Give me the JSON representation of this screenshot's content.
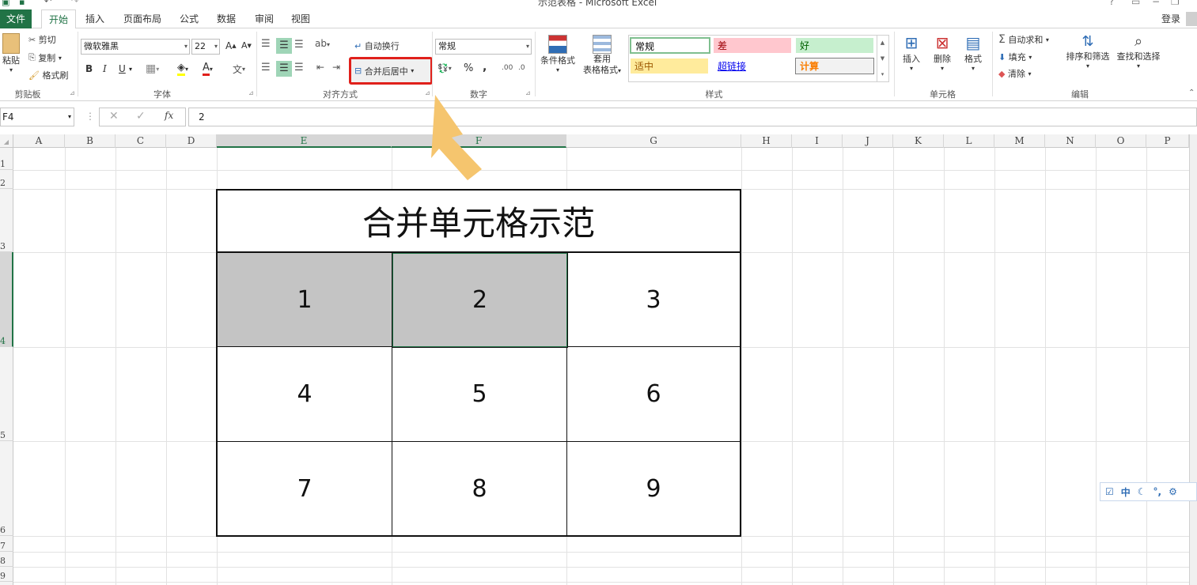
{
  "window": {
    "title": "示范表格 - Microsoft Excel",
    "login": "登录"
  },
  "tabs": [
    {
      "label": "文件"
    },
    {
      "label": "开始"
    },
    {
      "label": "插入"
    },
    {
      "label": "页面布局"
    },
    {
      "label": "公式"
    },
    {
      "label": "数据"
    },
    {
      "label": "审阅"
    },
    {
      "label": "视图"
    }
  ],
  "clipboard": {
    "paste": "粘贴",
    "cut": "剪切",
    "copy": "复制",
    "format_painter": "格式刷",
    "group": "剪贴板"
  },
  "font": {
    "name": "微软雅黑",
    "size": "22",
    "bold": "B",
    "italic": "I",
    "underline": "U",
    "grow": "A",
    "shrink": "A",
    "color_letter": "A",
    "wen": "文",
    "group": "字体"
  },
  "alignment": {
    "wrap_text": "自动换行",
    "merge_center": "合并后居中",
    "group": "对齐方式"
  },
  "number": {
    "format": "常规",
    "percent": "%",
    "comma": ",",
    "group": "数字"
  },
  "styles": {
    "conditional": "条件格式",
    "table_format": [
      "套用",
      "表格格式"
    ],
    "cells": [
      {
        "label": "常规",
        "bg": "#ffffff",
        "color": "#000000"
      },
      {
        "label": "差",
        "bg": "#ffc7ce",
        "color": "#9c0006"
      },
      {
        "label": "好",
        "bg": "#c6efce",
        "color": "#006100"
      },
      {
        "label": "适中",
        "bg": "#ffeb9c",
        "color": "#9c5700"
      },
      {
        "label": "超链接",
        "bg": "#ffffff",
        "color": "#0000ee"
      },
      {
        "label": "计算",
        "bg": "#f2f2f2",
        "color": "#fa7d00"
      }
    ],
    "group": "样式"
  },
  "cells_group": {
    "insert": "插入",
    "delete": "删除",
    "format": "格式",
    "group": "单元格"
  },
  "editing": {
    "autosum": "自动求和",
    "fill": "填充",
    "clear": "清除",
    "sort_filter": "排序和筛选",
    "find_select": "查找和选择",
    "group": "编辑",
    "sigma": "Σ"
  },
  "formula_bar": {
    "name_box": "F4",
    "fx": "fx",
    "value": "2"
  },
  "columns": [
    "A",
    "B",
    "C",
    "D",
    "E",
    "F",
    "G",
    "H",
    "I",
    "J",
    "K",
    "L",
    "M",
    "N",
    "O",
    "P"
  ],
  "rows": [
    "1",
    "2",
    "3",
    "4",
    "5",
    "6",
    "7",
    "8",
    "9"
  ],
  "sheet": {
    "title": "合并单元格示范",
    "grid": [
      [
        "1",
        "2",
        "3"
      ],
      [
        "4",
        "5",
        "6"
      ],
      [
        "7",
        "8",
        "9"
      ]
    ]
  },
  "ime": {
    "lang": "中"
  },
  "colors": {
    "excel_green": "#217346",
    "highlight_red": "#e0201b",
    "arrow": "#f5c56e",
    "selected_fill": "#c4c4c4"
  }
}
